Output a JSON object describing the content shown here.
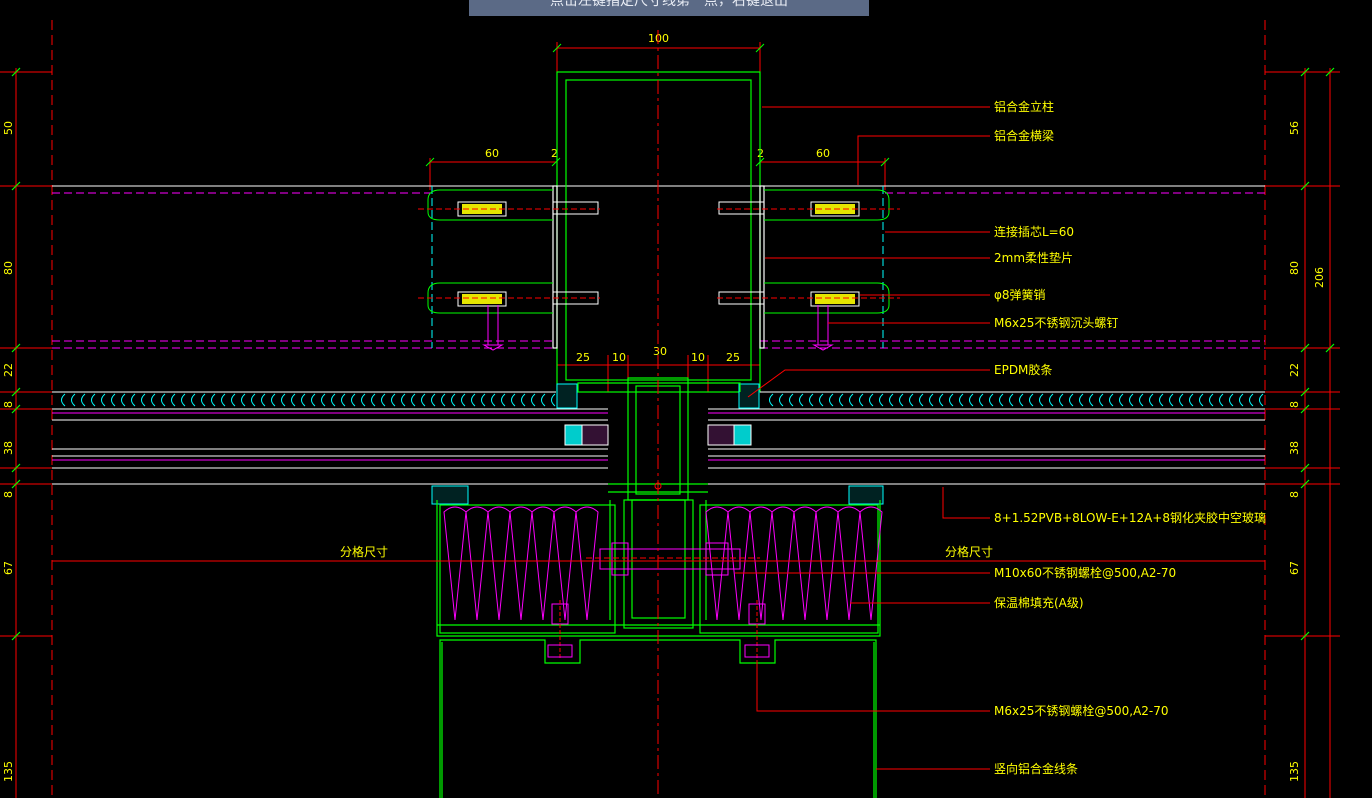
{
  "command_prompt": "点击左键指定尺寸线第一点，右键退出",
  "colors": {
    "background": "#000000",
    "profile": "#00ff00",
    "leader": "#ff0000",
    "text": "#ffff00",
    "dimension": "#ff0000",
    "hidden": "#ff00ff",
    "glass": "#ffffff",
    "seal": "#00ffff",
    "prompt_bar": "#5b6a86"
  },
  "dimensions": {
    "top_width": "100",
    "left_60": "60",
    "left_2": "2",
    "right_2": "2",
    "right_60": "60",
    "left_25": "25",
    "left_10": "10",
    "center_30": "30",
    "right_10": "10",
    "right_25": "25",
    "left_side": [
      "50",
      "80",
      "22",
      "8",
      "38",
      "8",
      "67",
      "135"
    ],
    "right_side": [
      "56",
      "80",
      "22",
      "8",
      "38",
      "8",
      "67",
      "135"
    ],
    "right_total": "206"
  },
  "callouts": [
    "铝合金立柱",
    "铝合金横梁",
    "连接插芯L=60",
    "2mm柔性垫片",
    "φ8弹簧销",
    "M6x25不锈钢沉头螺钉",
    "EPDM胶条",
    "8+1.52PVB+8LOW-E+12A+8钢化夹胶中空玻璃",
    "M10x60不锈钢螺栓@500,A2-70",
    "保温棉填充(A级)",
    "M6x25不锈钢螺栓@500,A2-70",
    "竖向铝合金线条"
  ],
  "grid_labels": {
    "left": "分格尺寸",
    "right": "分格尺寸"
  }
}
